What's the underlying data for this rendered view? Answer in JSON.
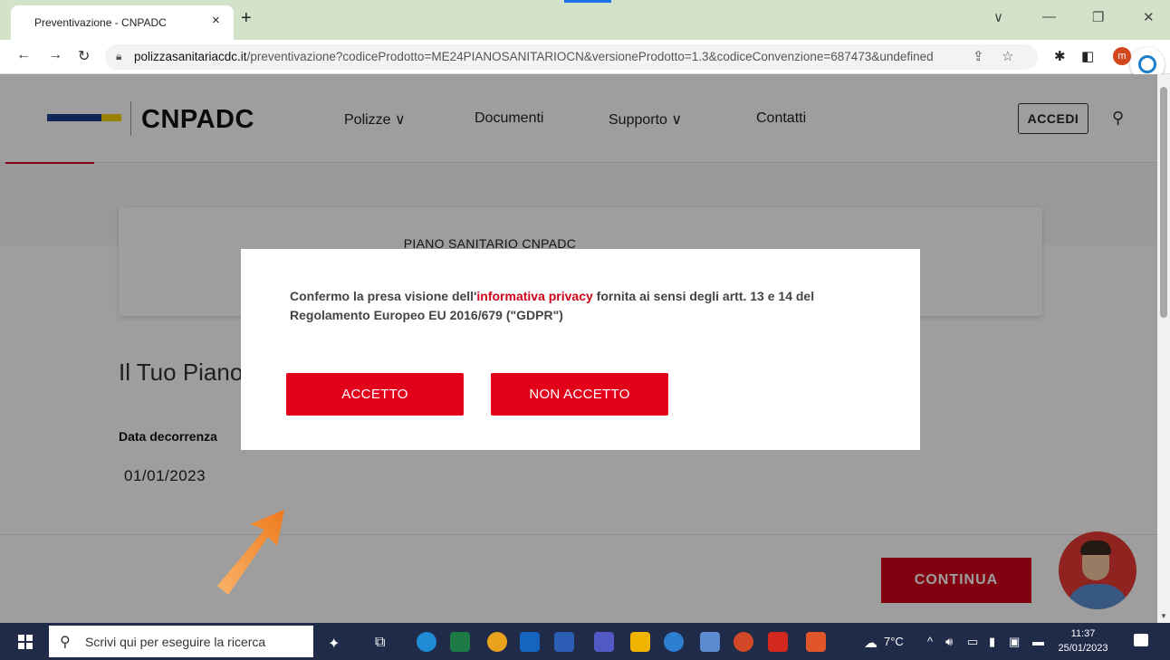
{
  "browser": {
    "tab_title": "Preventivazione - CNPADC",
    "tab_close": "×",
    "new_tab": "+",
    "url_domain": "polizzasanitariacdc.it",
    "url_path": "/preventivazione?codiceProdotto=ME24PIANOSANITARIOCN&versioneProdotto=1.3&codiceConvenzione=687473&undefined",
    "profile_initial": "m"
  },
  "header": {
    "brand": "CNPADC",
    "nav": [
      "Polizze ∨",
      "Documenti",
      "Supporto ∨",
      "Contatti"
    ],
    "login_label": "ACCEDI"
  },
  "page": {
    "product_title": "PIANO SANITARIO CNPADC",
    "plan_heading": "Il Tuo Piano",
    "start_date_label": "Data decorrenza",
    "start_date_value": "01/01/2023",
    "continue_label": "CONTINUA"
  },
  "modal": {
    "text_before": "Confermo la presa visione dell'",
    "link_text": "informativa privacy",
    "text_after": " fornita ai sensi degli artt. 13 e 14 del Regolamento Europeo EU 2016/679 (\"GDPR\")",
    "accept_label": "ACCETTO",
    "decline_label": "NON ACCETTO"
  },
  "taskbar": {
    "search_placeholder": "Scrivi qui per eseguire la ricerca",
    "weather": "7°C",
    "time": "11:37",
    "date": "25/01/2023"
  },
  "colors": {
    "brand_red": "#d0021b",
    "button_red": "#e2001a",
    "arrow_orange": "#f28a2e"
  }
}
